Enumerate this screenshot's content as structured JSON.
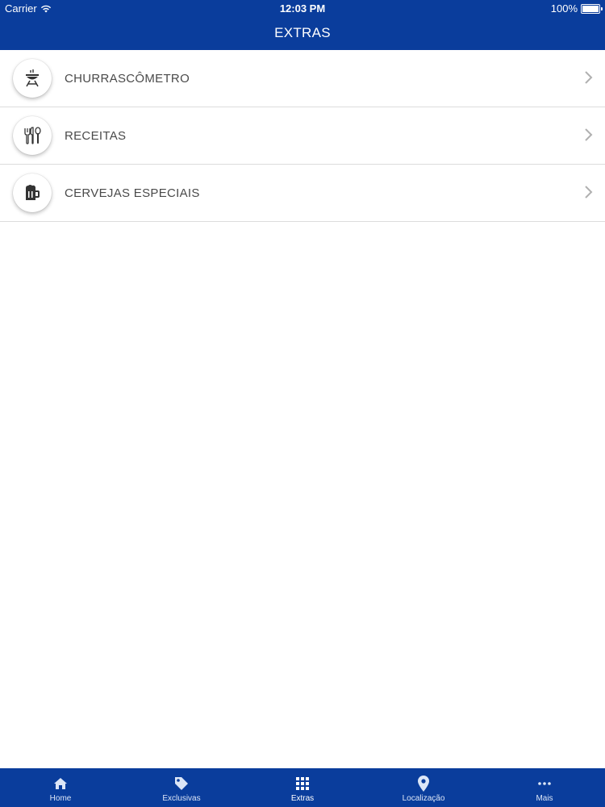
{
  "status_bar": {
    "carrier": "Carrier",
    "time": "12:03 PM",
    "battery": "100%"
  },
  "header": {
    "title": "EXTRAS"
  },
  "list": {
    "items": [
      {
        "label": "CHURRASCÔMETRO",
        "icon": "grill-icon"
      },
      {
        "label": "RECEITAS",
        "icon": "utensils-icon"
      },
      {
        "label": "CERVEJAS ESPECIAIS",
        "icon": "beer-mug-icon"
      }
    ]
  },
  "tabbar": {
    "tabs": [
      {
        "label": "Home",
        "icon": "home-icon"
      },
      {
        "label": "Exclusivas",
        "icon": "tag-icon"
      },
      {
        "label": "Extras",
        "icon": "grid-icon",
        "active": true
      },
      {
        "label": "Localização",
        "icon": "location-pin-icon"
      },
      {
        "label": "Mais",
        "icon": "more-dots-icon"
      }
    ]
  },
  "colors": {
    "brand_blue": "#0a3d9c",
    "text": "#4a4a4a",
    "divider": "#dcdcdc"
  }
}
